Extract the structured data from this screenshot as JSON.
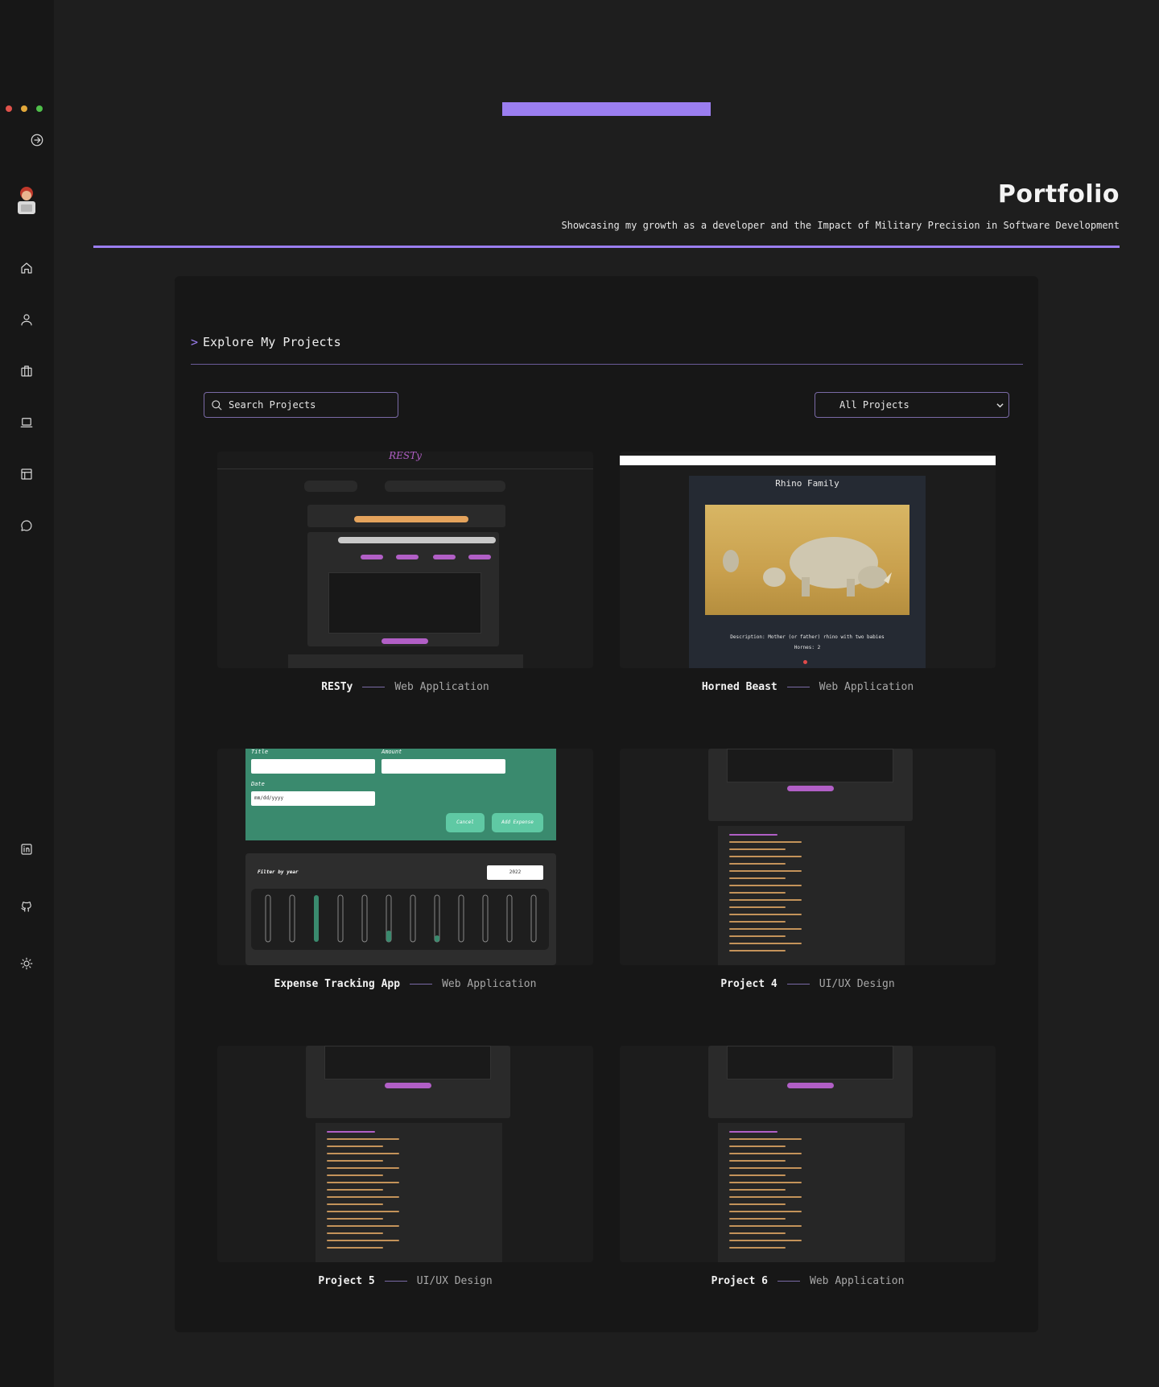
{
  "sidebar": {
    "icons": [
      "login-icon",
      "home-icon",
      "user-icon",
      "briefcase-icon",
      "laptop-icon",
      "layout-icon",
      "chat-icon",
      "linkedin-icon",
      "github-icon",
      "sun-icon"
    ]
  },
  "header": {
    "title": "Portfolio",
    "subtitle": "Showcasing my growth as a developer and the Impact of Military Precision in Software Development",
    "accent": "#9b7ef0"
  },
  "panel": {
    "heading_prefix": ">",
    "heading": "Explore My Projects",
    "search_placeholder": "Search Projects",
    "filter_value": "All Projects"
  },
  "projects": [
    {
      "name": "RESTy",
      "type": "Web Application"
    },
    {
      "name": "Horned Beast",
      "type": "Web Application"
    },
    {
      "name": "Expense Tracking App",
      "type": "Web Application"
    },
    {
      "name": "Project 4",
      "type": "UI/UX Design"
    },
    {
      "name": "Project 5",
      "type": "UI/UX Design"
    },
    {
      "name": "Project 6",
      "type": "Web Application"
    }
  ],
  "thumbs": {
    "resty_title": "RESTy",
    "horned_title": "Rhino Family",
    "horned_desc": "Description: Mother (or father) rhino with two babies",
    "horned_votes": "Hornes: 2",
    "expense_filter_label": "Filter by year",
    "expense_year": "2022",
    "expense_title_label": "Title",
    "expense_amount_label": "Amount",
    "expense_date_label": "Date",
    "expense_date_placeholder": "mm/dd/yyyy",
    "expense_cancel": "Cancel",
    "expense_add": "Add Expense"
  }
}
